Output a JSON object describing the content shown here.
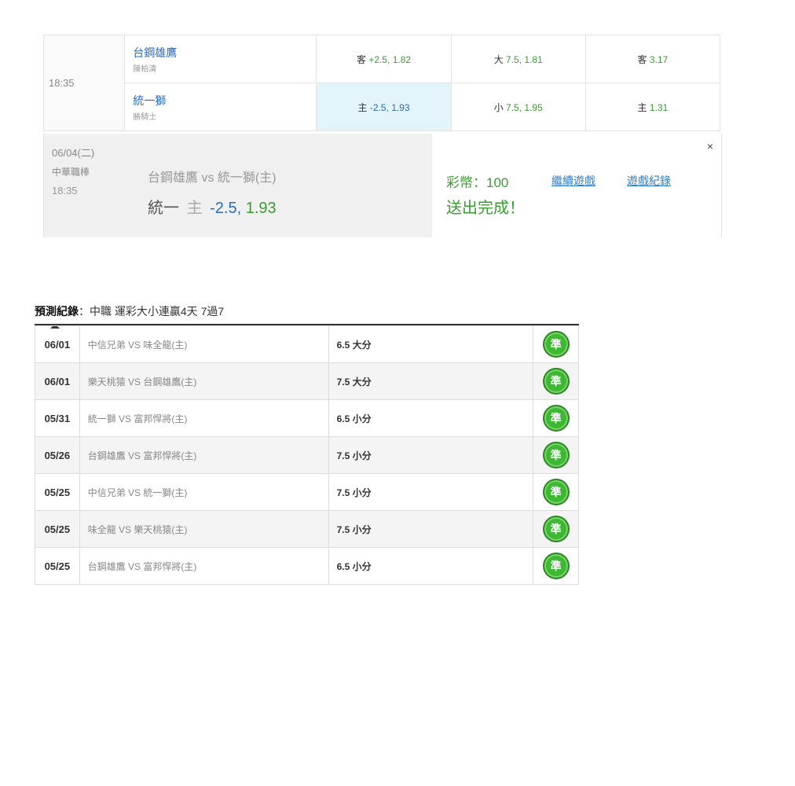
{
  "match": {
    "time": "18:35",
    "away": {
      "team": "台鋼雄鷹",
      "pitcher": "陳柏清",
      "spread_label": "客",
      "spread_value": "+2.5, 1.82",
      "total_label": "大",
      "total_value": "7.5, 1.81",
      "ml_label": "客",
      "ml_value": "3.17"
    },
    "home": {
      "team": "統一獅",
      "pitcher": "勝騎士",
      "spread_label": "主",
      "spread_value": "-2.5, 1.93",
      "total_label": "小",
      "total_value": "7.5, 1.95",
      "ml_label": "主",
      "ml_value": "1.31"
    }
  },
  "confirm": {
    "date": "06/04(二)",
    "league": "中華職棒",
    "time": "18:35",
    "matchup": "台鋼雄鷹 vs 統一獅(主)",
    "pick_team": "統一",
    "pick_side": "主",
    "pick_line": "-2.5,",
    "pick_price": "1.93",
    "coins": "彩幣：100",
    "status": "送出完成！",
    "continue_link": "繼續遊戲",
    "history_link": "遊戲紀錄",
    "close": "×"
  },
  "records": {
    "title_bold": "預測紀錄",
    "title_rest": "：中職 運彩大小連贏4天 7過7",
    "rows": [
      {
        "date": "06/01",
        "game": "中信兄弟 VS 味全龍(主)",
        "pick": "6.5 大分",
        "result": "準"
      },
      {
        "date": "06/01",
        "game": "樂天桃猿 VS 台鋼雄鷹(主)",
        "pick": "7.5 大分",
        "result": "準"
      },
      {
        "date": "05/31",
        "game": "統一獅 VS 富邦悍將(主)",
        "pick": "6.5 小分",
        "result": "準"
      },
      {
        "date": "05/26",
        "game": "台鋼雄鷹 VS 富邦悍將(主)",
        "pick": "7.5 小分",
        "result": "準"
      },
      {
        "date": "05/25",
        "game": "中信兄弟 VS 統一獅(主)",
        "pick": "7.5 小分",
        "result": "準"
      },
      {
        "date": "05/25",
        "game": "味全龍 VS 樂天桃猿(主)",
        "pick": "7.5 小分",
        "result": "準"
      },
      {
        "date": "05/25",
        "game": "台鋼雄鷹 VS 富邦悍將(主)",
        "pick": "6.5 小分",
        "result": "準"
      }
    ]
  }
}
